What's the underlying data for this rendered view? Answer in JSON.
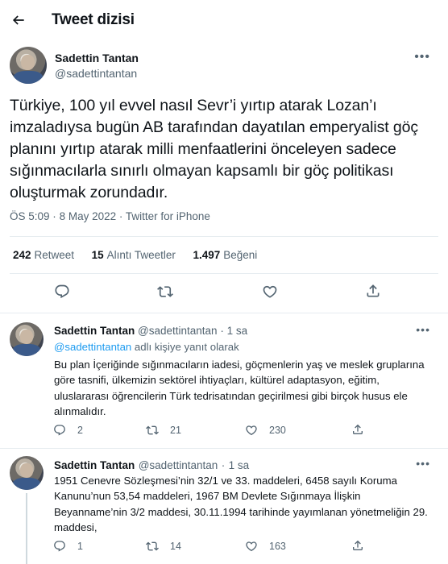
{
  "header": {
    "title": "Tweet dizisi",
    "back_icon": "arrow-left-icon"
  },
  "main_tweet": {
    "author_name": "Sadettin Tantan",
    "author_handle": "@sadettintantan",
    "text": "Türkiye, 100 yıl evvel nasıl Sevr’i yırtıp atarak Lozan’ı imzaladıysa bugün AB tarafından dayatılan emperyalist göç planını yırtıp atarak milli menfaatlerini önceleyen sadece sığınmacılarla sınırlı olmayan kapsamlı bir göç politikası oluşturmak zorundadır.",
    "time": "ÖS 5:09",
    "date": "8 May 2022",
    "source": "Twitter for iPhone",
    "separator": "·",
    "stats": {
      "retweets_count": "242",
      "retweets_label": "Retweet",
      "quotes_count": "15",
      "quotes_label": "Alıntı Tweetler",
      "likes_count": "1.497",
      "likes_label": "Beğeni"
    }
  },
  "replies": [
    {
      "author_name": "Sadettin Tantan",
      "author_handle": "@sadettintantan",
      "time": "1 sa",
      "replying_to_handle": "@sadettintantan",
      "replying_to_suffix": "adlı kişiye yanıt olarak",
      "text": "Bu plan İçeriğinde sığınmacıların iadesi, göçmenlerin yaş ve meslek gruplarına göre tasnifi, ülkemizin sektörel ihtiyaçları, kültürel adaptasyon, eğitim, uluslararası öğrencilerin Türk tedrisatından geçirilmesi gibi birçok husus ele alınmalıdır.",
      "reply_count": "2",
      "retweet_count": "21",
      "like_count": "230"
    },
    {
      "author_name": "Sadettin Tantan",
      "author_handle": "@sadettintantan",
      "time": "1 sa",
      "text": "1951 Cenevre Sözleşmesi’nin 32/1 ve 33. maddeleri, 6458 sayılı Koruma Kanunu’nun 53,54 maddeleri, 1967 BM Devlete Sığınmaya İlişkin Beyanname’nin 3/2 maddesi, 30.11.1994 tarihinde yayımlanan yönetmeliğin 29. maddesi,",
      "reply_count": "1",
      "retweet_count": "14",
      "like_count": "163"
    }
  ],
  "colors": {
    "accent": "#1d9bf0",
    "secondary_text": "#536471",
    "divider": "#e6ecf0"
  }
}
